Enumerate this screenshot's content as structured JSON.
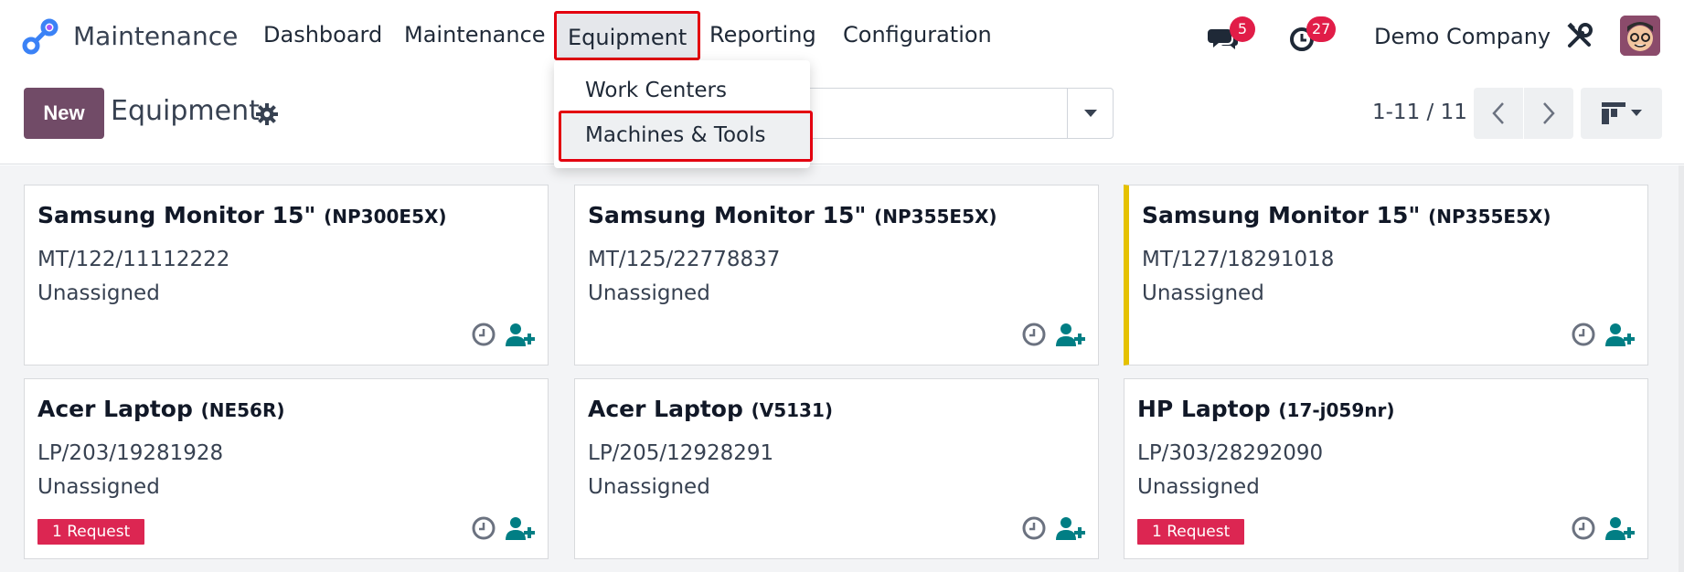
{
  "nav": {
    "app_name": "Maintenance",
    "menu": [
      "Dashboard",
      "Maintenance",
      "Equipment",
      "Reporting",
      "Configuration"
    ],
    "active_menu": "Equipment",
    "messages_count": "5",
    "activities_count": "27",
    "company": "Demo Company",
    "icons": [
      "app-logo-icon",
      "chat-icon",
      "clock-icon",
      "tools-icon",
      "avatar"
    ]
  },
  "control": {
    "new_label": "New",
    "title": "Equipment",
    "pager": "1-11 / 11"
  },
  "dropdown": {
    "items": [
      "Work Centers",
      "Machines & Tools"
    ],
    "highlighted": "Machines & Tools"
  },
  "cards": [
    {
      "name": "Samsung Monitor 15\"",
      "model": "(NP300E5X)",
      "serial": "MT/122/11112222",
      "owner": "Unassigned",
      "badge": ""
    },
    {
      "name": "Samsung Monitor 15\"",
      "model": "(NP355E5X)",
      "serial": "MT/125/22778837",
      "owner": "Unassigned",
      "badge": ""
    },
    {
      "name": "Samsung Monitor 15\"",
      "model": "(NP355E5X)",
      "serial": "MT/127/18291018",
      "owner": "Unassigned",
      "badge": ""
    },
    {
      "name": "Acer Laptop",
      "model": "(NE56R)",
      "serial": "LP/203/19281928",
      "owner": "Unassigned",
      "badge": "1 Request"
    },
    {
      "name": "Acer Laptop",
      "model": "(V5131)",
      "serial": "LP/205/12928291",
      "owner": "Unassigned",
      "badge": ""
    },
    {
      "name": "HP Laptop",
      "model": "(17-j059nr)",
      "serial": "LP/303/28292090",
      "owner": "Unassigned",
      "badge": "1 Request"
    }
  ],
  "colors": {
    "brand": "#714b67",
    "highlight_border": "#e3000f",
    "badge_red": "#e11d48",
    "request_badge": "#dc2652",
    "teal_icon": "#017e84",
    "flag_yellow": "#e5c100"
  }
}
